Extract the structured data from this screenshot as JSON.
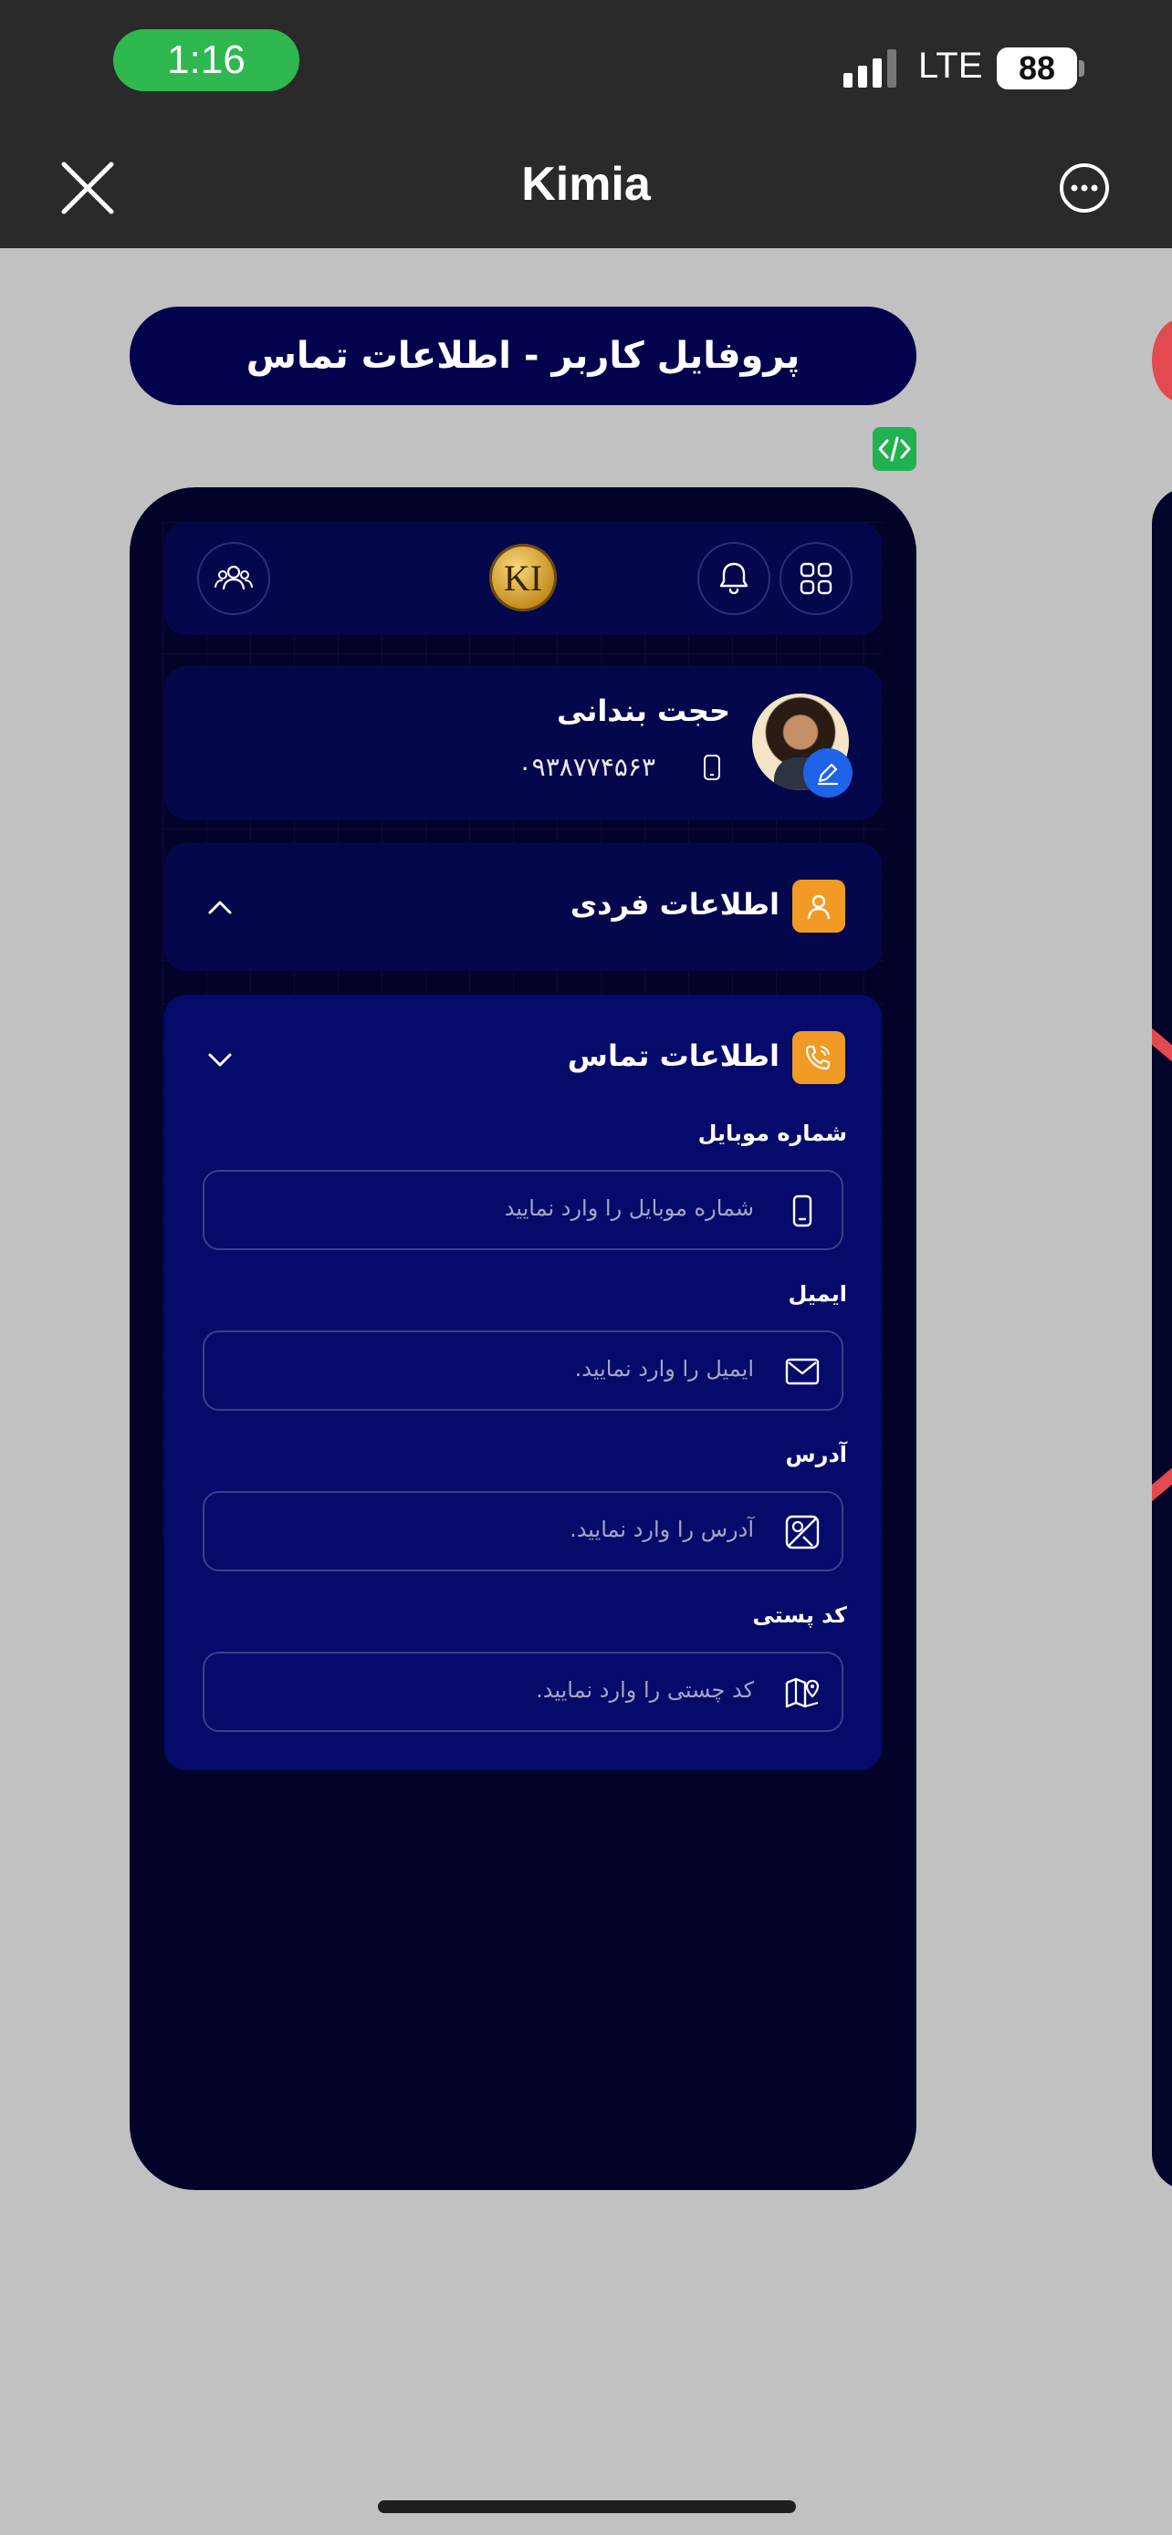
{
  "status": {
    "time": "1:16",
    "network": "LTE",
    "battery": "88"
  },
  "nav": {
    "title": "Kimia"
  },
  "header": {
    "title": "پروفایل کاربر - اطلاعات تماس"
  },
  "app": {
    "logo_text": "KI",
    "user": {
      "name": "حجت بندانی",
      "phone": "۰۹۳۸۷۷۴۵۶۳"
    },
    "sections": {
      "personal": {
        "title": "اطلاعات فردی"
      },
      "contact": {
        "title": "اطلاعات تماس"
      }
    },
    "fields": [
      {
        "label": "شماره موبایل",
        "placeholder": "شماره موبایل را وارد نمایید",
        "icon": "mobile-icon"
      },
      {
        "label": "ایمیل",
        "placeholder": "ایمیل را وارد نمایید.",
        "icon": "mail-icon"
      },
      {
        "label": "آدرس",
        "placeholder": "آدرس را وارد نمایید.",
        "icon": "map-location-icon"
      },
      {
        "label": "کد پستی",
        "placeholder": "کد چستی را وارد نمایید.",
        "icon": "map-pin-icon"
      }
    ]
  },
  "colors": {
    "brand_dark": "#03034d",
    "accent_orange": "#f29a26",
    "edit_blue": "#1e63e8",
    "code_green": "#22b151"
  }
}
